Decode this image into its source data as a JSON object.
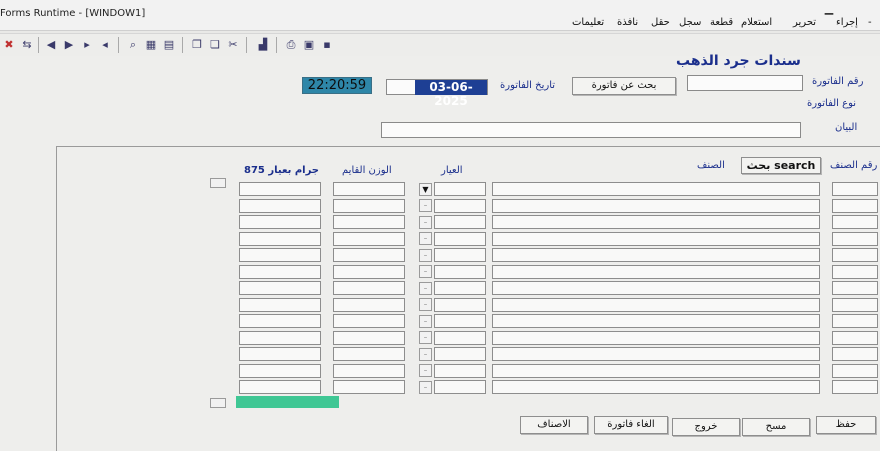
{
  "window": {
    "title": "Forms Runtime - [WINDOW1]",
    "minimize_icon": "minimize-icon"
  },
  "menu": {
    "items": [
      "إجراء",
      "تحرير",
      "استعلام",
      "قطعة",
      "سجل",
      "حقل",
      "نافذة",
      "تعليمات"
    ]
  },
  "toolbar": {
    "icons": [
      "exit-icon",
      "save-icon",
      "print-icon",
      "cut-icon",
      "copy-icon",
      "paste-icon",
      "query-icon",
      "execute-icon",
      "cancel-icon",
      "prev-block-icon",
      "prev-record-icon",
      "next-record-icon",
      "next-block-icon",
      "insert-icon",
      "delete-icon",
      "help-icon"
    ]
  },
  "form": {
    "heading": "سندات جرد الذهب",
    "invoice_number_label": "رقم الفاتورة",
    "invoice_number_value": "",
    "search_invoice_button": "بحث عن فاتورة",
    "invoice_date_label": "تاريخ الفاتورة",
    "invoice_date_value": "03-06-2025",
    "clock_value": "22:20:59",
    "invoice_type_label": "نوع الفاتورة",
    "statement_label": "البيان",
    "statement_value": ""
  },
  "grid": {
    "item_number_header": "رقم الصنف",
    "search_button": "بحث search",
    "item_header": "الصنف",
    "karat_header": "العيار",
    "old_weight_header": "الوزن القايم",
    "grams_header": "جرام بعيار 875",
    "row_count": 13,
    "total_color": "#3fc794"
  },
  "footer": {
    "save_label": "حفظ",
    "clear_label": "مسح",
    "exit_label": "خروج",
    "cancel_invoice_label": "الغاء فاتورة",
    "items_label": "الاصناف"
  }
}
